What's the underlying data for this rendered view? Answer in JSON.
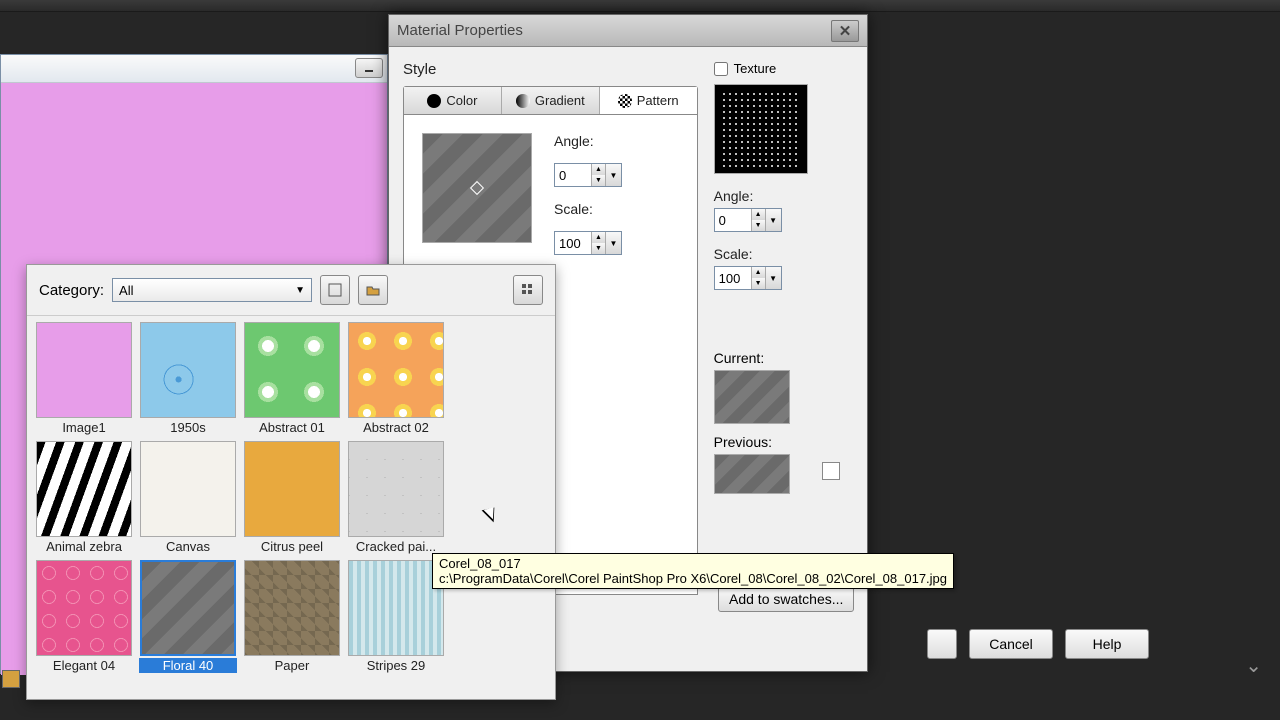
{
  "app": {
    "top_areas": ""
  },
  "dialog": {
    "title": "Material Properties",
    "style_label": "Style",
    "tabs": {
      "color": "Color",
      "gradient": "Gradient",
      "pattern": "Pattern"
    },
    "angle_label": "Angle:",
    "angle_value": "0",
    "scale_label": "Scale:",
    "scale_value": "100",
    "texture_label": "Texture",
    "tex_angle_label": "Angle:",
    "tex_angle_value": "0",
    "tex_scale_label": "Scale:",
    "tex_scale_value": "100",
    "current_label": "Current:",
    "previous_label": "Previous:",
    "add_swatch": "Add to swatches...",
    "cancel": "Cancel",
    "help": "Help"
  },
  "picker": {
    "category_label": "Category:",
    "category_value": "All",
    "items": [
      {
        "label": "Image1",
        "cls": "i-image1"
      },
      {
        "label": "1950s",
        "cls": "i-1950s"
      },
      {
        "label": "Abstract 01",
        "cls": "i-ab1"
      },
      {
        "label": "Abstract 02",
        "cls": "i-ab2"
      },
      {
        "label": "Animal zebra",
        "cls": "i-zebra"
      },
      {
        "label": "Canvas",
        "cls": "i-canvas"
      },
      {
        "label": "Citrus peel",
        "cls": "i-citrus"
      },
      {
        "label": "Cracked pai...",
        "cls": "i-cracked"
      },
      {
        "label": "Elegant 04",
        "cls": "i-elegant"
      },
      {
        "label": "Floral 40",
        "cls": "i-floral",
        "selected": true
      },
      {
        "label": "Paper",
        "cls": "i-paper"
      },
      {
        "label": "Stripes 29",
        "cls": "i-stripes"
      }
    ]
  },
  "tooltip": {
    "name": "Corel_08_017",
    "path": "c:\\ProgramData\\Corel\\Corel PaintShop Pro X6\\Corel_08\\Corel_08_02\\Corel_08_017.jpg"
  }
}
